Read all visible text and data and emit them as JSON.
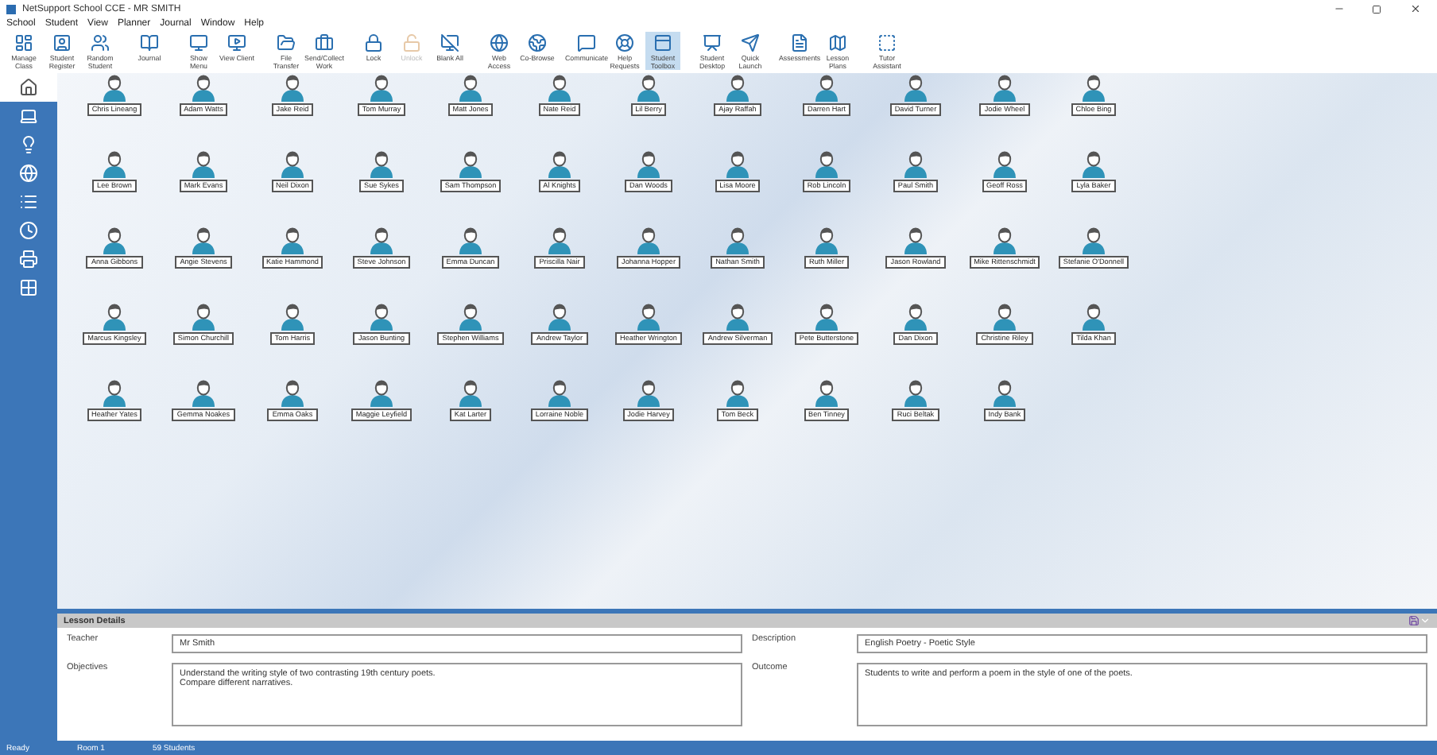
{
  "window": {
    "title": "NetSupport School CCE - MR SMITH"
  },
  "menu": [
    "School",
    "Student",
    "View",
    "Planner",
    "Journal",
    "Window",
    "Help"
  ],
  "toolbar": [
    [
      {
        "label": "Manage Class",
        "selected": false,
        "disabled": false
      },
      {
        "label": "Student Register",
        "selected": false,
        "disabled": false
      },
      {
        "label": "Random Student",
        "selected": false,
        "disabled": false
      }
    ],
    [
      {
        "label": "Journal",
        "selected": false,
        "disabled": false
      }
    ],
    [
      {
        "label": "Show Menu",
        "selected": false,
        "disabled": false
      },
      {
        "label": "View Client",
        "selected": false,
        "disabled": false
      }
    ],
    [
      {
        "label": "File Transfer",
        "selected": false,
        "disabled": false
      },
      {
        "label": "Send/Collect Work",
        "selected": false,
        "disabled": false
      }
    ],
    [
      {
        "label": "Lock",
        "selected": false,
        "disabled": false
      },
      {
        "label": "Unlock",
        "selected": false,
        "disabled": true
      },
      {
        "label": "Blank All",
        "selected": false,
        "disabled": false
      }
    ],
    [
      {
        "label": "Web Access",
        "selected": false,
        "disabled": false
      },
      {
        "label": "Co-Browse",
        "selected": false,
        "disabled": false
      }
    ],
    [
      {
        "label": "Communicate",
        "selected": false,
        "disabled": false
      },
      {
        "label": "Help Requests",
        "selected": false,
        "disabled": false
      },
      {
        "label": "Student Toolbox",
        "selected": true,
        "disabled": false
      }
    ],
    [
      {
        "label": "Student Desktop",
        "selected": false,
        "disabled": false
      },
      {
        "label": "Quick Launch",
        "selected": false,
        "disabled": false
      }
    ],
    [
      {
        "label": "Assessments",
        "selected": false,
        "disabled": false
      },
      {
        "label": "Lesson Plans",
        "selected": false,
        "disabled": false
      }
    ],
    [
      {
        "label": "Tutor Assistant",
        "selected": false,
        "disabled": false
      }
    ]
  ],
  "students": [
    "Chris Lineang",
    "Adam Watts",
    "Jake Reid",
    "Tom Murray",
    "Matt Jones",
    "Nate Reid",
    "Lil Berry",
    "Ajay Raffah",
    "Darren Hart",
    "David Turner",
    "Jodie Wheel",
    "Chloe Bing",
    "Lee Brown",
    "Mark Evans",
    "Neil Dixon",
    "Sue Sykes",
    "Sam Thompson",
    "Al Knights",
    "Dan Woods",
    "Lisa Moore",
    "Rob Lincoln",
    "Paul Smith",
    "Geoff Ross",
    "Lyla Baker",
    "Anna Gibbons",
    "Angie Stevens",
    "Katie Hammond",
    "Steve Johnson",
    "Emma Duncan",
    "Priscilla Nair",
    "Johanna Hopper",
    "Nathan Smith",
    "Ruth Miller",
    "Jason Rowland",
    "Mike Rittenschmidt",
    "Stefanie O'Donnell",
    "Marcus Kingsley",
    "Simon Churchill",
    "Tom Harris",
    "Jason Bunting",
    "Stephen Williams",
    "Andrew Taylor",
    "Heather Wrington",
    "Andrew Silverman",
    "Pete Butterstone",
    "Dan Dixon",
    "Christine Riley",
    "Tilda Khan",
    "Heather Yates",
    "Gemma Noakes",
    "Emma Oaks",
    "Maggie Leyfield",
    "Kat Larter",
    "Lorraine Noble",
    "Jodie Harvey",
    "Tom Beck",
    "Ben Tinney",
    "Ruci Beltak",
    "Indy Bank"
  ],
  "lesson_details": {
    "title": "Lesson Details",
    "fields": [
      {
        "label": "Teacher",
        "value": "Mr Smith",
        "kind": "line"
      },
      {
        "label": "Description",
        "value": "English Poetry - Poetic Style",
        "kind": "line"
      },
      {
        "label": "Objectives",
        "value": "Understand the writing style of two contrasting 19th century poets.\nCompare different narratives.",
        "kind": "area"
      },
      {
        "label": "Outcome",
        "value": "Students to write and perform a poem in the style of one of the poets.",
        "kind": "area"
      }
    ]
  },
  "status_bar": {
    "state": "Ready",
    "room": "Room 1",
    "count": "59 Students"
  }
}
